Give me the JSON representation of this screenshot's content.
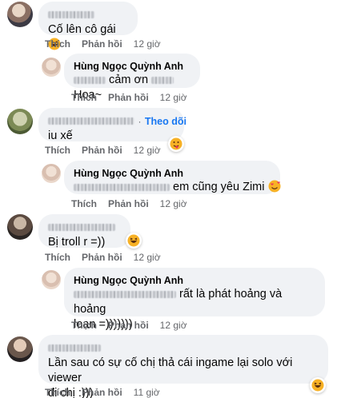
{
  "labels": {
    "like": "Thích",
    "reply": "Phản hồi",
    "follow": "Theo dõi"
  },
  "comments": [
    {
      "text": "Cố lên cô gái",
      "time": "12 giờ",
      "reaction": "haha-icon"
    },
    {
      "author": "Hùng Ngọc Quỳnh Anh",
      "text": "cảm ơn",
      "text2": "Hoa~",
      "time": "12 giờ"
    },
    {
      "text": "iu xế",
      "time": "12 giờ",
      "reaction": "care-icon"
    },
    {
      "author": "Hùng Ngọc Quỳnh Anh",
      "text": "em cũng yêu Zimi",
      "time": "12 giờ"
    },
    {
      "text": "Bị troll r =))",
      "time": "12 giờ",
      "reaction": "haha-icon"
    },
    {
      "author": "Hùng Ngọc Quỳnh Anh",
      "text": "rất là phát hoảng và hoảng",
      "text2": "loạn =)))))))",
      "time": "12 giờ"
    },
    {
      "text": "Lần sau có sự cố chị thả cái ingame lại solo với viewer",
      "text2": "đi chị :)))",
      "time": "11 giờ",
      "reaction": "haha-icon"
    }
  ],
  "colors": {
    "bubble": "#f0f2f5",
    "link": "#1877f2",
    "meta": "#65676b"
  }
}
